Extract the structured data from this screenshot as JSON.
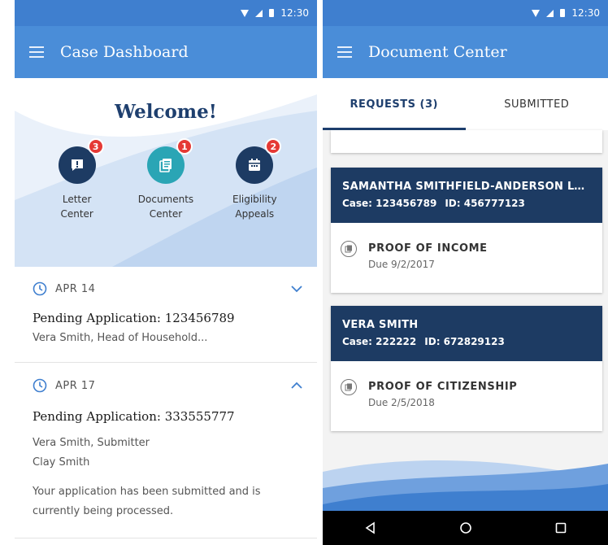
{
  "status_bar": {
    "time": "12:30"
  },
  "left": {
    "appbar_title": "Case Dashboard",
    "welcome": "Welcome!",
    "quick_actions": [
      {
        "line1": "Letter",
        "line2": "Center",
        "badge": "3",
        "icon": "alert-icon",
        "color": "#1d3b63"
      },
      {
        "line1": "Documents",
        "line2": "Center",
        "badge": "1",
        "icon": "documents-icon",
        "color": "#2aa5b5"
      },
      {
        "line1": "Eligibility",
        "line2": "Appeals",
        "badge": "2",
        "icon": "calendar-icon",
        "color": "#1d3b63"
      }
    ],
    "entries": [
      {
        "date": "APR 14",
        "title": "Pending Application: 123456789",
        "lines": [
          "Vera Smith, Head of Household..."
        ],
        "expanded": false
      },
      {
        "date": "APR 17",
        "title": "Pending Application: 333555777",
        "lines": [
          "Vera Smith, Submitter",
          "Clay Smith",
          "Your application has been submitted and is",
          "currently being processed."
        ],
        "expanded": true
      }
    ]
  },
  "right": {
    "appbar_title": "Document Center",
    "tabs": [
      {
        "label": "REQUESTS (3)",
        "active": true
      },
      {
        "label": "SUBMITTED",
        "active": false
      }
    ],
    "cards": [
      {
        "name": "SAMANTHA SMITHFIELD-ANDERSON LONG...",
        "case": "Case: 123456789",
        "id": "ID: 456777123",
        "doc_title": "PROOF OF INCOME",
        "due": "Due 9/2/2017"
      },
      {
        "name": "VERA SMITH",
        "case": "Case: 222222",
        "id": "ID: 672829123",
        "doc_title": "PROOF OF CITIZENSHIP",
        "due": "Due 2/5/2018"
      }
    ]
  },
  "colors": {
    "primary": "#4a8dd8",
    "navy": "#1d3b63",
    "teal": "#2aa5b5",
    "badge": "#e53935"
  }
}
